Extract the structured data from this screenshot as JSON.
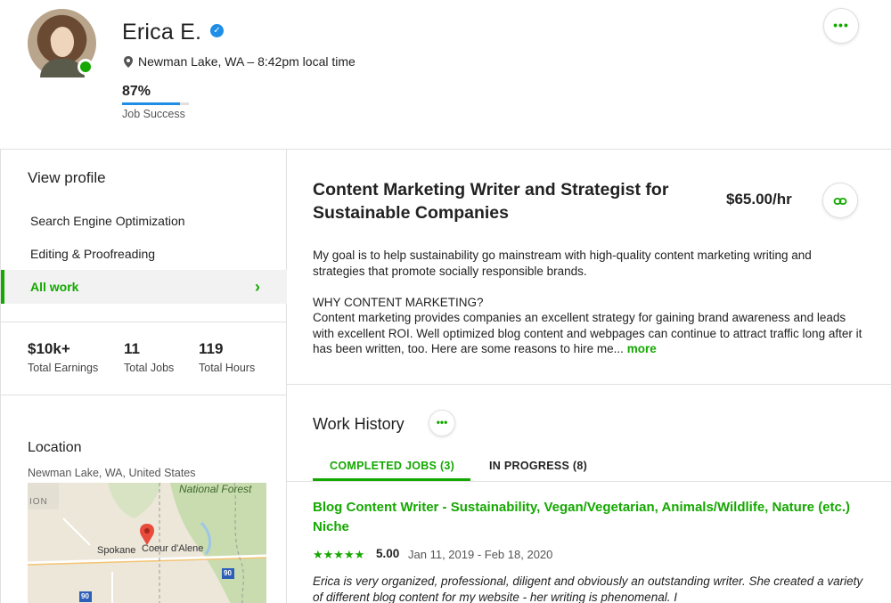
{
  "profile": {
    "name": "Erica E.",
    "location": "Newman Lake, WA – 8:42pm local time",
    "job_success_pct": "87%",
    "job_success_value": 0.87,
    "job_success_label": "Job Success"
  },
  "sidebar": {
    "view_profile": "View profile",
    "items": [
      {
        "label": "Search Engine Optimization"
      },
      {
        "label": "Editing & Proofreading"
      },
      {
        "label": "All work"
      }
    ]
  },
  "stats": [
    {
      "value": "$10k+",
      "label": "Total Earnings"
    },
    {
      "value": "11",
      "label": "Total Jobs"
    },
    {
      "value": "119",
      "label": "Total Hours"
    }
  ],
  "location": {
    "title": "Location",
    "subtitle": "Newman Lake, WA, United States",
    "map_labels": {
      "forest": "National Forest",
      "ion": "ION",
      "city1": "Spokane",
      "city2": "Coeur d'Alene",
      "hw1": "90",
      "hw2": "90"
    }
  },
  "main": {
    "title": "Content Marketing Writer and Strategist for Sustainable Companies",
    "rate": "$65.00/hr",
    "desc_p1": "My goal is to help sustainability go mainstream with high-quality content marketing writing and strategies that promote socially responsible brands.",
    "desc_p2_heading": "WHY CONTENT MARKETING?",
    "desc_p2": "Content marketing provides companies an excellent strategy for gaining brand awareness and leads with excellent ROI. Well optimized blog content and webpages can continue to attract traffic long after it has been written, too. Here are some reasons to hire me... ",
    "more": "more"
  },
  "work_history": {
    "title": "Work History",
    "tabs": [
      {
        "label": "COMPLETED JOBS (3)"
      },
      {
        "label": "IN PROGRESS (8)"
      }
    ],
    "job": {
      "title": "Blog Content Writer - Sustainability, Vegan/Vegetarian, Animals/Wildlife, Nature (etc.) Niche",
      "stars": "★★★★★",
      "rating": "5.00",
      "dates": "Jan 11, 2019 - Feb 18, 2020",
      "review": "Erica is very organized, professional, diligent and obviously an outstanding writer. She created a variety of different blog content for my website - her writing is phenomenal. I"
    }
  },
  "colors": {
    "accent": "#14a800",
    "verified": "#1f8ee6"
  }
}
